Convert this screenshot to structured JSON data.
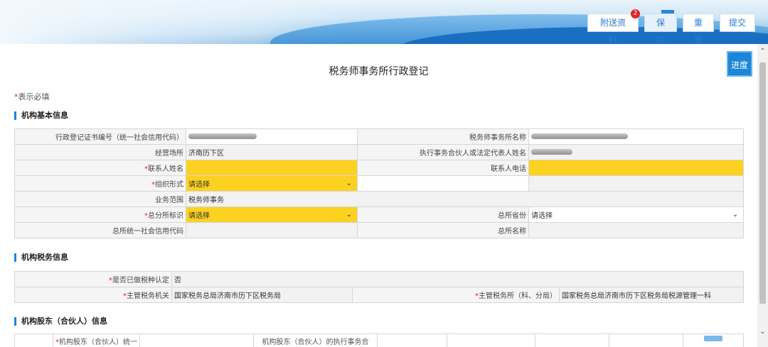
{
  "toolbar": {
    "attach_label": "附送资料",
    "attach_badge": "2",
    "save_label": "保存",
    "reset_label": "重置",
    "submit_label": "提交"
  },
  "progress_label": "进度",
  "page_title": "税务师事务所行政登记",
  "required_note": "表示必填",
  "sections": {
    "basic": "机构基本信息",
    "tax": "机构税务信息",
    "shareholders": "机构股东（合伙人）信息"
  },
  "basic": {
    "cert_code_label": "行政登记证书编号（统一社会信用代码）",
    "firm_name_label": "税务师事务所名称",
    "address_label": "经营场所",
    "address_value": "济南历下区",
    "partner_label": "执行事务合伙人或法定代表人姓名",
    "contact_name_label": "联系人姓名",
    "contact_phone_label": "联系人电话",
    "org_form_label": "组织形式",
    "org_form_value": "请选择",
    "scope_label": "业务范围",
    "scope_value": "税务师事务",
    "branch_label": "总分所标识",
    "branch_value": "请选择",
    "hq_province_label": "总所省份",
    "hq_province_value": "请选择",
    "hq_code_label": "总所统一社会信用代码",
    "hq_name_label": "总所名称"
  },
  "tax": {
    "recognized_label": "是否已做税种认定",
    "recognized_value": "否",
    "authority_label": "主管税务机关",
    "authority_value": "国家税务总局济南市历下区税务局",
    "office_label": "主管税务所（科、分局）",
    "office_value": "国家税务总局济南市历下区税务局税源管理一科"
  },
  "shareholders_table": {
    "col1": "机构股东（合伙人）统一",
    "col2": "机构股东（合伙人）的执行事务合"
  },
  "colors": {
    "required_fill": "#fcd120",
    "accent": "#1c86d9",
    "required_star": "#e02424"
  }
}
